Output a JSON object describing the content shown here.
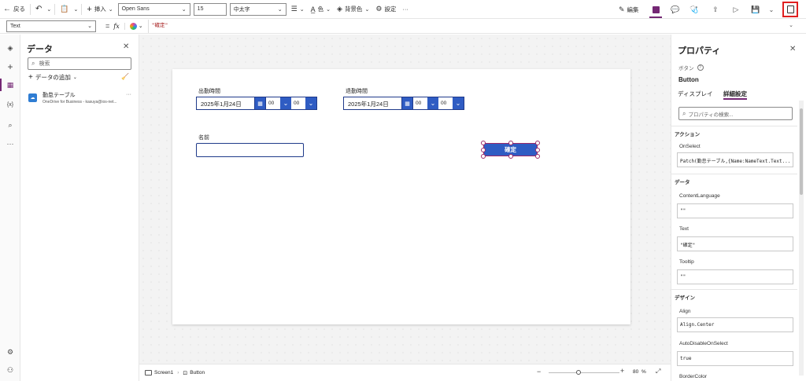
{
  "toolbar": {
    "back_label": "戻る",
    "insert_label": "挿入",
    "font_name": "Open Sans",
    "font_size": "15",
    "font_weight": "中太字",
    "color_label": "色",
    "fill_label": "背景色",
    "settings_label": "設定",
    "more": "···",
    "edit_label": "編集"
  },
  "formula": {
    "property": "Text",
    "equals": "=",
    "fx": "fx",
    "value": "\"確定\""
  },
  "data_panel": {
    "title": "データ",
    "search_placeholder": "検索",
    "add_data_label": "データの追加",
    "sources": [
      {
        "name": "勤怠テーブル",
        "subtitle": "OneDrive for Business - kasuya@ios-net..."
      }
    ]
  },
  "canvas": {
    "clock_in_label": "出勤時間",
    "clock_in_date": "2025年1月24日",
    "clock_in_hour": "00",
    "clock_in_minute": "00",
    "clock_out_label": "退勤時間",
    "clock_out_date": "2025年1月24日",
    "clock_out_hour": "00",
    "clock_out_minute": "00",
    "name_label": "名前",
    "name_value": "",
    "confirm_button": "確定"
  },
  "status": {
    "screen": "Screen1",
    "control": "Button",
    "zoom": "80",
    "zoom_unit": "%"
  },
  "properties": {
    "title": "プロパティ",
    "control_type": "ボタン",
    "control_name": "Button",
    "tab_display": "ディスプレイ",
    "tab_advanced": "詳細設定",
    "search_placeholder": "プロパティの検索...",
    "section_action": "アクション",
    "onselect_label": "OnSelect",
    "onselect_value": "Patch(勤怠テーブル,{Name:NameText.Text...",
    "section_data": "データ",
    "contentlanguage_label": "ContentLanguage",
    "contentlanguage_value": "\"\"",
    "text_label": "Text",
    "text_value": "\"確定\"",
    "tooltip_label": "Tooltip",
    "tooltip_value": "\"\"",
    "section_design": "デザイン",
    "align_label": "Align",
    "align_value": "Align.Center",
    "autodisable_label": "AutoDisableOnSelect",
    "autodisable_value": "true",
    "bordercolor_label": "BorderColor"
  },
  "colors": {
    "accent": "#742774",
    "button_fill": "#2f5cc3",
    "highlight": "#e02020"
  }
}
